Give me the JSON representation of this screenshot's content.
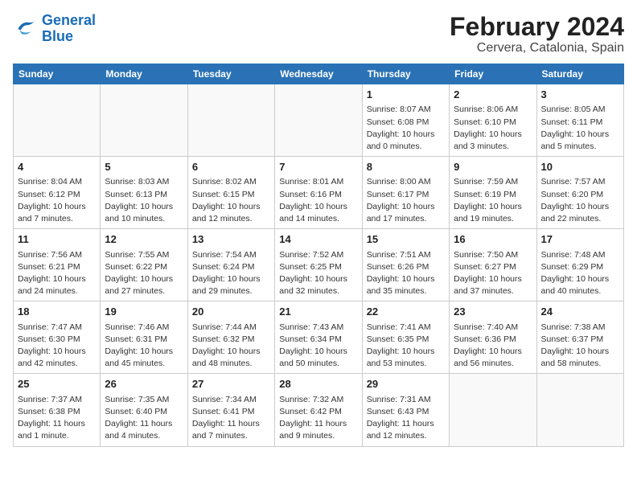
{
  "logo": {
    "line1": "General",
    "line2": "Blue"
  },
  "title": "February 2024",
  "subtitle": "Cervera, Catalonia, Spain",
  "weekdays": [
    "Sunday",
    "Monday",
    "Tuesday",
    "Wednesday",
    "Thursday",
    "Friday",
    "Saturday"
  ],
  "weeks": [
    [
      {
        "day": "",
        "info": ""
      },
      {
        "day": "",
        "info": ""
      },
      {
        "day": "",
        "info": ""
      },
      {
        "day": "",
        "info": ""
      },
      {
        "day": "1",
        "info": "Sunrise: 8:07 AM\nSunset: 6:08 PM\nDaylight: 10 hours\nand 0 minutes."
      },
      {
        "day": "2",
        "info": "Sunrise: 8:06 AM\nSunset: 6:10 PM\nDaylight: 10 hours\nand 3 minutes."
      },
      {
        "day": "3",
        "info": "Sunrise: 8:05 AM\nSunset: 6:11 PM\nDaylight: 10 hours\nand 5 minutes."
      }
    ],
    [
      {
        "day": "4",
        "info": "Sunrise: 8:04 AM\nSunset: 6:12 PM\nDaylight: 10 hours\nand 7 minutes."
      },
      {
        "day": "5",
        "info": "Sunrise: 8:03 AM\nSunset: 6:13 PM\nDaylight: 10 hours\nand 10 minutes."
      },
      {
        "day": "6",
        "info": "Sunrise: 8:02 AM\nSunset: 6:15 PM\nDaylight: 10 hours\nand 12 minutes."
      },
      {
        "day": "7",
        "info": "Sunrise: 8:01 AM\nSunset: 6:16 PM\nDaylight: 10 hours\nand 14 minutes."
      },
      {
        "day": "8",
        "info": "Sunrise: 8:00 AM\nSunset: 6:17 PM\nDaylight: 10 hours\nand 17 minutes."
      },
      {
        "day": "9",
        "info": "Sunrise: 7:59 AM\nSunset: 6:19 PM\nDaylight: 10 hours\nand 19 minutes."
      },
      {
        "day": "10",
        "info": "Sunrise: 7:57 AM\nSunset: 6:20 PM\nDaylight: 10 hours\nand 22 minutes."
      }
    ],
    [
      {
        "day": "11",
        "info": "Sunrise: 7:56 AM\nSunset: 6:21 PM\nDaylight: 10 hours\nand 24 minutes."
      },
      {
        "day": "12",
        "info": "Sunrise: 7:55 AM\nSunset: 6:22 PM\nDaylight: 10 hours\nand 27 minutes."
      },
      {
        "day": "13",
        "info": "Sunrise: 7:54 AM\nSunset: 6:24 PM\nDaylight: 10 hours\nand 29 minutes."
      },
      {
        "day": "14",
        "info": "Sunrise: 7:52 AM\nSunset: 6:25 PM\nDaylight: 10 hours\nand 32 minutes."
      },
      {
        "day": "15",
        "info": "Sunrise: 7:51 AM\nSunset: 6:26 PM\nDaylight: 10 hours\nand 35 minutes."
      },
      {
        "day": "16",
        "info": "Sunrise: 7:50 AM\nSunset: 6:27 PM\nDaylight: 10 hours\nand 37 minutes."
      },
      {
        "day": "17",
        "info": "Sunrise: 7:48 AM\nSunset: 6:29 PM\nDaylight: 10 hours\nand 40 minutes."
      }
    ],
    [
      {
        "day": "18",
        "info": "Sunrise: 7:47 AM\nSunset: 6:30 PM\nDaylight: 10 hours\nand 42 minutes."
      },
      {
        "day": "19",
        "info": "Sunrise: 7:46 AM\nSunset: 6:31 PM\nDaylight: 10 hours\nand 45 minutes."
      },
      {
        "day": "20",
        "info": "Sunrise: 7:44 AM\nSunset: 6:32 PM\nDaylight: 10 hours\nand 48 minutes."
      },
      {
        "day": "21",
        "info": "Sunrise: 7:43 AM\nSunset: 6:34 PM\nDaylight: 10 hours\nand 50 minutes."
      },
      {
        "day": "22",
        "info": "Sunrise: 7:41 AM\nSunset: 6:35 PM\nDaylight: 10 hours\nand 53 minutes."
      },
      {
        "day": "23",
        "info": "Sunrise: 7:40 AM\nSunset: 6:36 PM\nDaylight: 10 hours\nand 56 minutes."
      },
      {
        "day": "24",
        "info": "Sunrise: 7:38 AM\nSunset: 6:37 PM\nDaylight: 10 hours\nand 58 minutes."
      }
    ],
    [
      {
        "day": "25",
        "info": "Sunrise: 7:37 AM\nSunset: 6:38 PM\nDaylight: 11 hours\nand 1 minute."
      },
      {
        "day": "26",
        "info": "Sunrise: 7:35 AM\nSunset: 6:40 PM\nDaylight: 11 hours\nand 4 minutes."
      },
      {
        "day": "27",
        "info": "Sunrise: 7:34 AM\nSunset: 6:41 PM\nDaylight: 11 hours\nand 7 minutes."
      },
      {
        "day": "28",
        "info": "Sunrise: 7:32 AM\nSunset: 6:42 PM\nDaylight: 11 hours\nand 9 minutes."
      },
      {
        "day": "29",
        "info": "Sunrise: 7:31 AM\nSunset: 6:43 PM\nDaylight: 11 hours\nand 12 minutes."
      },
      {
        "day": "",
        "info": ""
      },
      {
        "day": "",
        "info": ""
      }
    ]
  ]
}
